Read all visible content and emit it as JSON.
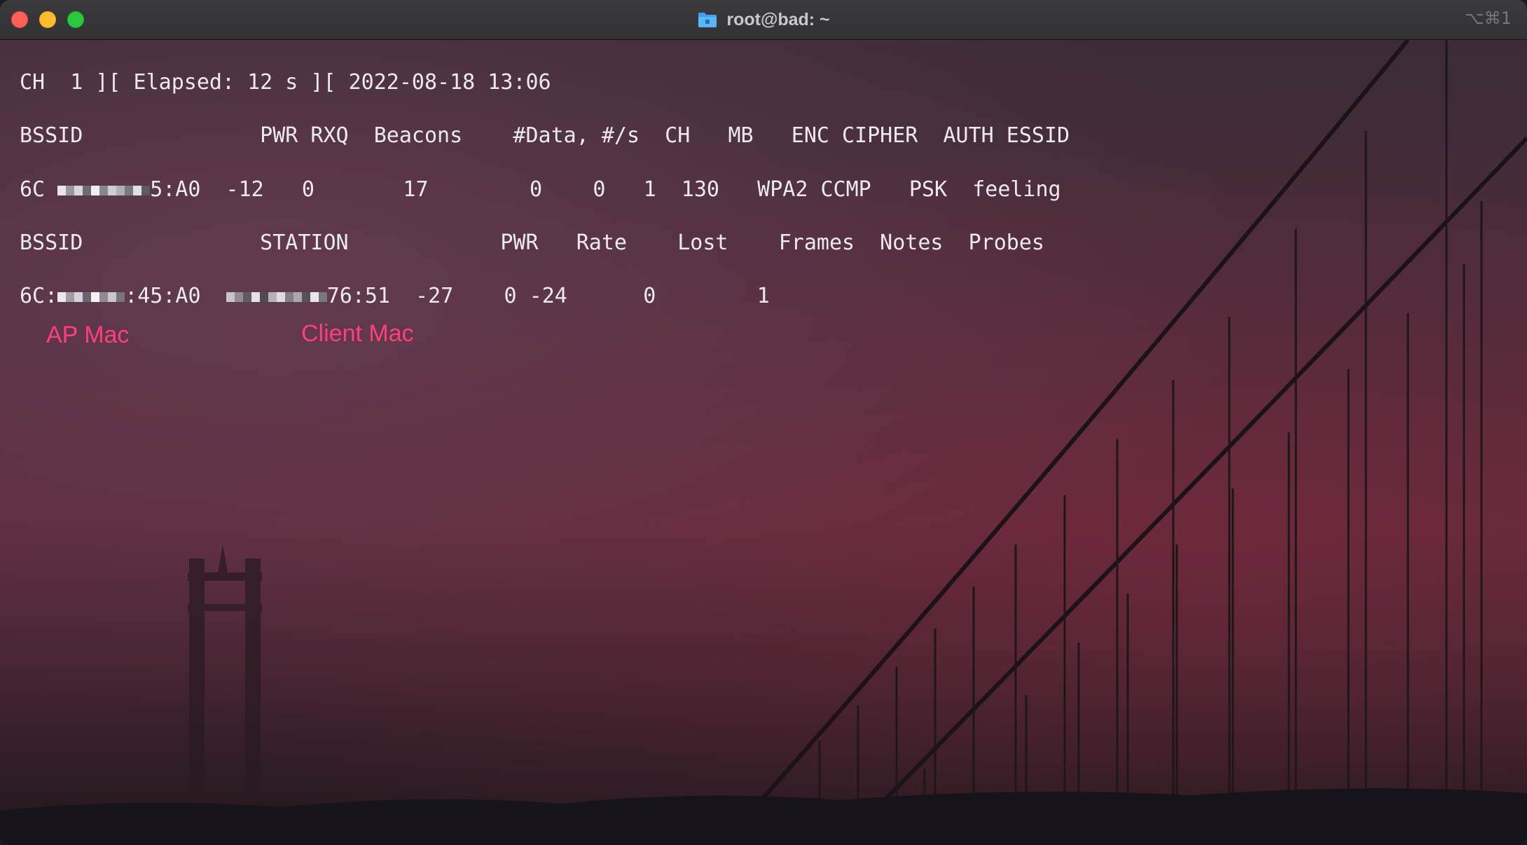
{
  "window": {
    "title": "root@bad: ~",
    "shortcut": "⌥⌘1"
  },
  "terminal": {
    "status_line": "CH  1 ][ Elapsed: 12 s ][ 2022-08-18 13:06",
    "ap_header": "BSSID              PWR RXQ  Beacons    #Data, #/s  CH   MB   ENC CIPHER  AUTH ESSID",
    "ap_row": {
      "bssid_prefix": "6C",
      "bssid_suffix": "5:A0",
      "rest": "  -12   0       17        0    0   1  130   WPA2 CCMP   PSK  feeling"
    },
    "station_header": "BSSID              STATION            PWR   Rate    Lost    Frames  Notes  Probes",
    "station_row": {
      "bssid_prefix": "6C:",
      "bssid_suffix": ":45:A0",
      "station_suffix": "76:51",
      "rest": "  -27    0 -24      0        1"
    }
  },
  "annotations": {
    "ap_mac": "AP Mac",
    "client_mac": "Client Mac"
  },
  "colors": {
    "annotation": "#ff3d7f",
    "terminal_text": "#eceaee"
  }
}
